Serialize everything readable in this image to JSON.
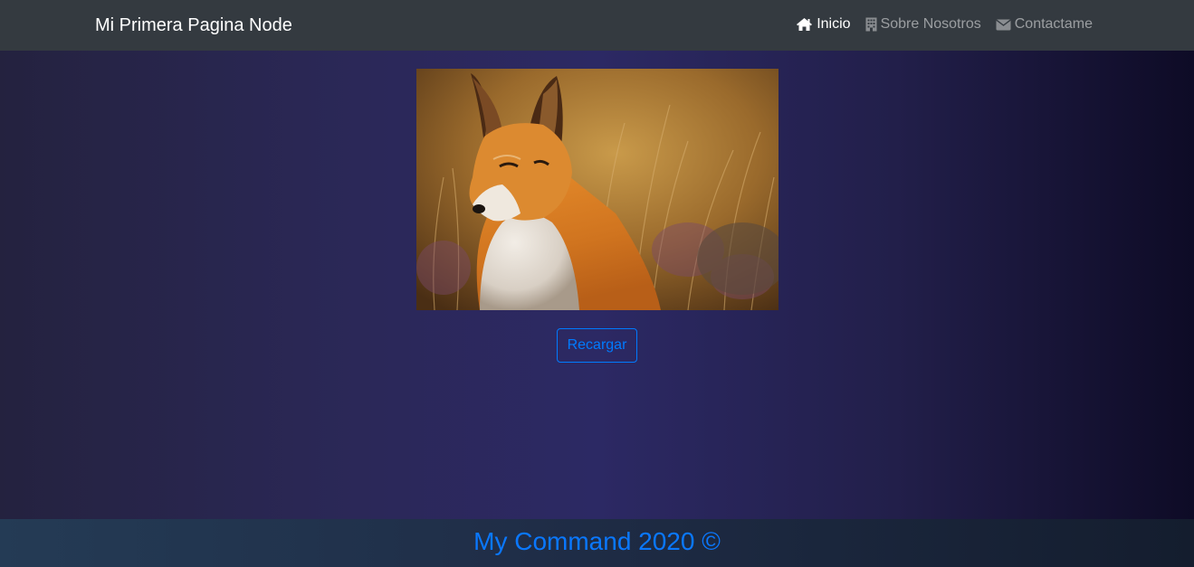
{
  "navbar": {
    "brand": "Mi Primera Pagina Node",
    "items": [
      {
        "label": "Inicio",
        "icon": "home-icon",
        "active": true
      },
      {
        "label": "Sobre Nosotros",
        "icon": "building-icon",
        "active": false
      },
      {
        "label": "Contactame",
        "icon": "envelope-icon",
        "active": false
      }
    ]
  },
  "main": {
    "image_subject": "fox-photo",
    "reload_label": "Recargar"
  },
  "footer": {
    "text": "My Command 2020 ©"
  },
  "colors": {
    "navbar_bg": "#343a40",
    "primary": "#007bff",
    "footer_text": "#0a78ff"
  }
}
